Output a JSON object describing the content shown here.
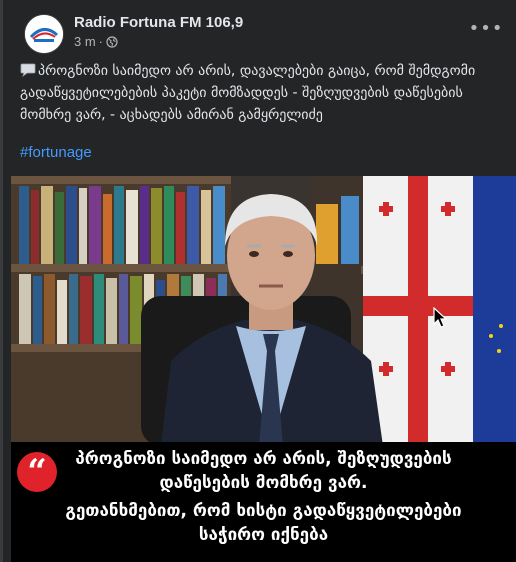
{
  "post": {
    "page_name": "Radio Fortuna FM 106,9",
    "time": "3 m",
    "separator": "·",
    "more_icon": "more-horizontal-icon",
    "audience_icon": "globe-icon",
    "text_emoji": "speech-balloon-icon",
    "text": "პროგნოზი საიმედო არ არის, დავალებები გაიცა, რომ შემდგომი გადაწყვეტილებების პაკეტი მომზადდეს - შეზღუდვების დაწესების მომხრე ვარ, - აცხადებს ამირან გამყრელიძე",
    "hashtag": "#fortunage"
  },
  "media": {
    "quote_glyph": "“",
    "banner_lines": [
      "პროგნოზი საიმედო არ არის, შეზღუდვების",
      "დაწესების მომხრე ვარ.",
      "გეთანხმებით, რომ ხისტი გადაწყვეტილებები",
      "საჭირო იქნება"
    ],
    "accent_color": "#e0232b"
  },
  "colors": {
    "background": "#242526",
    "text": "#e4e6eb",
    "secondary": "#b0b3b8",
    "link": "#4599ff"
  }
}
